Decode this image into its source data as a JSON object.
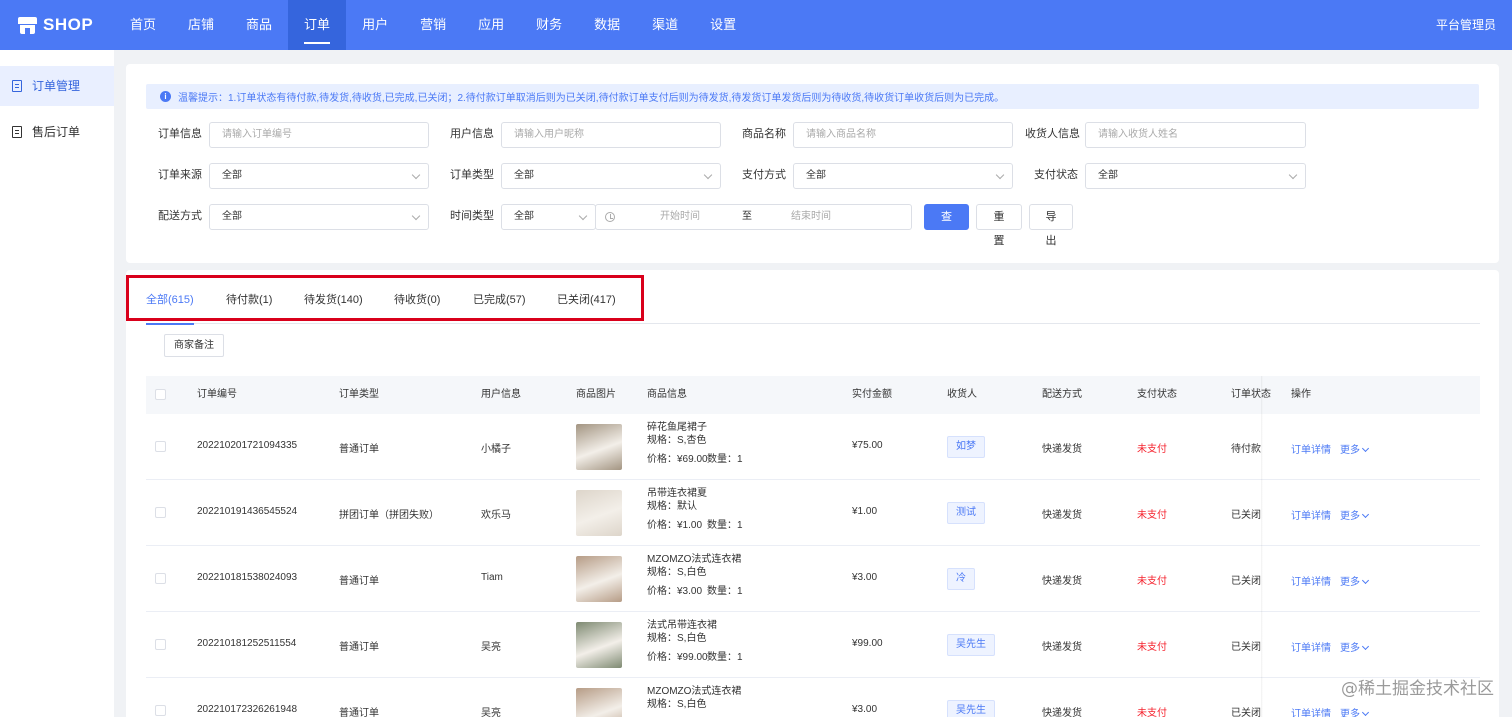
{
  "logo": {
    "text": "SHOP"
  },
  "nav": [
    "首页",
    "店铺",
    "商品",
    "订单",
    "用户",
    "营销",
    "应用",
    "财务",
    "数据",
    "渠道",
    "设置"
  ],
  "nav_active": "订单",
  "admin": "平台管理员",
  "sidebar": [
    {
      "label": "订单管理",
      "active": true
    },
    {
      "label": "售后订单",
      "active": false
    }
  ],
  "tip": "温馨提示：1.订单状态有待付款,待发货,待收货,已完成,已关闭；2.待付款订单取消后则为已关闭,待付款订单支付后则为待发货,待发货订单发货后则为待收货,待收货订单收货后则为已完成。",
  "filters": {
    "order_info": {
      "label": "订单信息",
      "placeholder": "请输入订单编号"
    },
    "user_info": {
      "label": "用户信息",
      "placeholder": "请输入用户昵称"
    },
    "product_name": {
      "label": "商品名称",
      "placeholder": "请输入商品名称"
    },
    "receiver_info": {
      "label": "收货人信息",
      "placeholder": "请输入收货人姓名"
    },
    "order_source": {
      "label": "订单来源",
      "value": "全部"
    },
    "order_type": {
      "label": "订单类型",
      "value": "全部"
    },
    "pay_method": {
      "label": "支付方式",
      "value": "全部"
    },
    "pay_status": {
      "label": "支付状态",
      "value": "全部"
    },
    "delivery": {
      "label": "配送方式",
      "value": "全部"
    },
    "time_type": {
      "label": "时间类型",
      "value": "全部"
    },
    "date_range": {
      "start": "开始时间",
      "sep": "至",
      "end": "结束时间"
    },
    "buttons": {
      "query": "查询",
      "reset": "重置",
      "export": "导出"
    }
  },
  "tabs": [
    "全部(615)",
    "待付款(1)",
    "待发货(140)",
    "待收货(0)",
    "已完成(57)",
    "已关闭(417)"
  ],
  "merchant_note": "商家备注",
  "columns": [
    "订单编号",
    "订单类型",
    "用户信息",
    "商品图片",
    "商品信息",
    "实付金额",
    "收货人",
    "配送方式",
    "支付状态",
    "订单状态",
    "操作"
  ],
  "rows": [
    {
      "no": "202210201721094335",
      "type": "普通订单",
      "user": "小橘子",
      "pname": "碎花鱼尾裙子",
      "spec": "规格：S,杏色",
      "price": "价格：¥69.00",
      "qty": "数量：1",
      "paid": "¥75.00",
      "receiver": "如梦",
      "delivery": "快递发货",
      "pay": "未支付",
      "status": "待付款",
      "op_detail": "订单详情",
      "op_more": "更多",
      "img": "#a39582"
    },
    {
      "no": "202210191436545524",
      "type": "拼团订单（拼团失败）",
      "user": "欢乐马",
      "pname": "吊带连衣裙夏",
      "spec": "规格：默认",
      "price": "价格：¥1.00",
      "qty": "数量：1",
      "paid": "¥1.00",
      "receiver": "测试",
      "delivery": "快递发货",
      "pay": "未支付",
      "status": "已关闭",
      "op_detail": "订单详情",
      "op_more": "更多",
      "img": "#ddd5ca"
    },
    {
      "no": "202210181538024093",
      "type": "普通订单",
      "user": "Tiam",
      "pname": "MZOMZO法式连衣裙",
      "spec": "规格：S,白色",
      "price": "价格：¥3.00",
      "qty": "数量：1",
      "paid": "¥3.00",
      "receiver": "冷",
      "delivery": "快递发货",
      "pay": "未支付",
      "status": "已关闭",
      "op_detail": "订单详情",
      "op_more": "更多",
      "img": "#b69c86"
    },
    {
      "no": "202210181252511554",
      "type": "普通订单",
      "user": "吴亮",
      "pname": "法式吊带连衣裙",
      "spec": "规格：S,白色",
      "price": "价格：¥99.00",
      "qty": "数量：1",
      "paid": "¥99.00",
      "receiver": "吴先生",
      "delivery": "快递发货",
      "pay": "未支付",
      "status": "已关闭",
      "op_detail": "订单详情",
      "op_more": "更多",
      "img": "#7e8a72"
    },
    {
      "no": "202210172326261948",
      "type": "普通订单",
      "user": "吴亮",
      "pname": "MZOMZO法式连衣裙",
      "spec": "规格：S,白色",
      "price": "",
      "qty": "",
      "paid": "¥3.00",
      "receiver": "吴先生",
      "delivery": "快递发货",
      "pay": "未支付",
      "status": "已关闭",
      "op_detail": "订单详情",
      "op_more": "更多",
      "img": "#b69c86"
    }
  ],
  "watermark": "@稀土掘金技术社区",
  "colors": {
    "primary": "#4b79f5",
    "highlight": "#d9001b",
    "unpaid": "#f5222d"
  }
}
